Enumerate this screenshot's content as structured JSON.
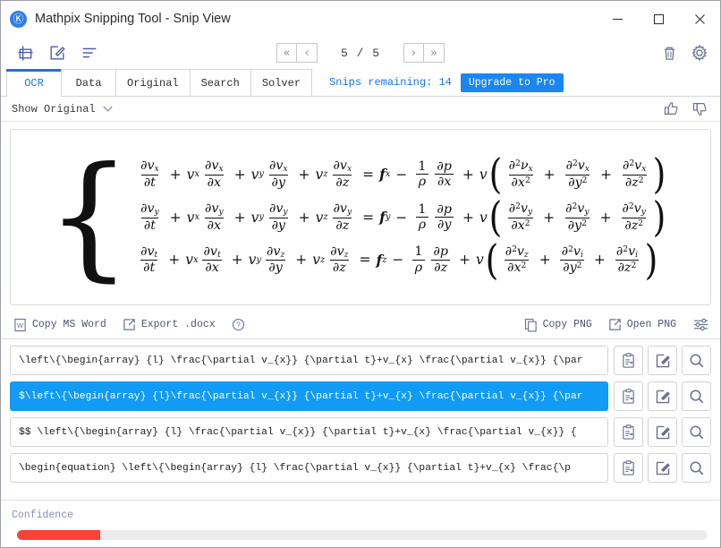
{
  "window": {
    "title": "Mathpix Snipping Tool - Snip View",
    "logo_glyph": "Ⓚ",
    "minimize_label": "–",
    "maximize_label": "□",
    "close_label": "✕"
  },
  "toolbar": {
    "icons": [
      {
        "name": "new-snip-icon",
        "label": "New Snip"
      },
      {
        "name": "edit-snip-icon",
        "label": "Edit Snip"
      },
      {
        "name": "list-view-icon",
        "label": "List View"
      }
    ],
    "pager": {
      "first_label": "«",
      "prev_label": "‹",
      "count": "5 / 5",
      "next_label": "›",
      "last_label": "»"
    },
    "right_icons": [
      {
        "name": "trash-icon",
        "label": "Delete"
      },
      {
        "name": "gear-icon",
        "label": "Settings"
      }
    ]
  },
  "tabs": [
    {
      "label": "OCR",
      "active": true
    },
    {
      "label": "Data",
      "active": false
    },
    {
      "label": "Original",
      "active": false
    },
    {
      "label": "Search",
      "active": false
    },
    {
      "label": "Solver",
      "active": false
    }
  ],
  "snips": {
    "remaining_text": "Snips remaining: 14",
    "upgrade_label": "Upgrade to Pro"
  },
  "show_original": {
    "label": "Show Original",
    "thumbs_up": "thumbs-up-icon",
    "thumbs_down": "thumbs-down-icon"
  },
  "equation": {
    "description": "Navier-Stokes momentum equations, three component rows",
    "rows": [
      {
        "lhs_terms": [
          {
            "num": "∂v",
            "num_sub": "x",
            "den": "∂t"
          },
          {
            "coef": "v",
            "coef_sub": "x",
            "num": "∂v",
            "num_sub": "x",
            "den": "∂x"
          },
          {
            "coef": "v",
            "coef_sub": "y",
            "num": "∂v",
            "num_sub": "x",
            "den": "∂y"
          },
          {
            "coef": "v",
            "coef_sub": "z",
            "num": "∂v",
            "num_sub": "x",
            "den": "∂z"
          }
        ],
        "rhs_force": "f",
        "rhs_force_sub": "x",
        "pressure_den": "∂x",
        "visc_terms": [
          {
            "num": "∂²ν",
            "num_sub": "x",
            "den": "∂x",
            "den_sup": "2"
          },
          {
            "num": "∂²v",
            "num_sub": "x",
            "den": "∂y",
            "den_sup": "2"
          },
          {
            "num": "∂²v",
            "num_sub": "x",
            "den": "∂z",
            "den_sup": "2"
          }
        ]
      },
      {
        "lhs_terms": [
          {
            "num": "∂v",
            "num_sub": "y",
            "den": "∂t"
          },
          {
            "coef": "v",
            "coef_sub": "x",
            "num": "∂v",
            "num_sub": "y",
            "den": "∂x"
          },
          {
            "coef": "v",
            "coef_sub": "y",
            "num": "∂v",
            "num_sub": "y",
            "den": "∂y"
          },
          {
            "coef": "v",
            "coef_sub": "z",
            "num": "∂v",
            "num_sub": "y",
            "den": "∂z"
          }
        ],
        "rhs_force": "f",
        "rhs_force_sub": "y",
        "pressure_den": "∂y",
        "visc_terms": [
          {
            "num": "∂²v",
            "num_sub": "y",
            "den": "∂x",
            "den_sup": "2"
          },
          {
            "num": "∂²v",
            "num_sub": "y",
            "den": "∂y",
            "den_sup": "2"
          },
          {
            "num": "∂²v",
            "num_sub": "y",
            "den": "∂z",
            "den_sup": "2"
          }
        ]
      },
      {
        "lhs_terms": [
          {
            "num": "∂v",
            "num_sub": "t",
            "den": "∂t"
          },
          {
            "coef": "v",
            "coef_sub": "x",
            "num": "∂v",
            "num_sub": "t",
            "den": "∂x"
          },
          {
            "coef": "v",
            "coef_sub": "y",
            "num": "∂v",
            "num_sub": "z",
            "den": "∂y"
          },
          {
            "coef": "v",
            "coef_sub": "z",
            "num": "∂v",
            "num_sub": "z",
            "den": "∂z"
          }
        ],
        "rhs_force": "f",
        "rhs_force_sub": "z",
        "pressure_den": "∂z",
        "visc_terms": [
          {
            "num": "∂²v",
            "num_sub": "z",
            "den": "∂x",
            "den_sup": "2"
          },
          {
            "num": "∂²v",
            "num_sub": "i",
            "den": "∂y",
            "den_sup": "2"
          },
          {
            "num": "∂²v",
            "num_sub": "i",
            "den": "∂z",
            "den_sup": "2"
          }
        ]
      }
    ],
    "symbols": {
      "plus": "+",
      "equals": "=",
      "minus": "−",
      "one": "1",
      "rho": "ρ",
      "partial_p": "∂p",
      "nu": "v"
    }
  },
  "action_bar": {
    "copy_ms_word": "Copy MS Word",
    "export_docx": "Export .docx",
    "help": "?",
    "copy_png": "Copy PNG",
    "open_png": "Open PNG",
    "settings_icon": "sliders-icon"
  },
  "results": [
    {
      "text": "\\left\\{\\begin{array} {l} \\frac{\\partial v_{x}} {\\partial t}+v_{x} \\frac{\\partial v_{x}} {\\par",
      "selected": false
    },
    {
      "text": "$\\left\\{\\begin{array} {l}\\frac{\\partial v_{x}} {\\partial t}+v_{x} \\frac{\\partial v_{x}} {\\par",
      "selected": true
    },
    {
      "text": "$$  \\left\\{\\begin{array} {l} \\frac{\\partial v_{x}} {\\partial t}+v_{x} \\frac{\\partial v_{x}} {",
      "selected": false
    },
    {
      "text": "\\begin{equation}  \\left\\{\\begin{array} {l} \\frac{\\partial v_{x}} {\\partial t}+v_{x} \\frac{\\p",
      "selected": false
    }
  ],
  "row_buttons": [
    {
      "name": "copy-row-icon",
      "label": "Copy"
    },
    {
      "name": "edit-row-icon",
      "label": "Edit"
    },
    {
      "name": "preview-row-icon",
      "label": "Preview"
    }
  ],
  "confidence": {
    "label": "Confidence",
    "percent": 12,
    "fill_color": "#f9423a",
    "track_color": "#ececec"
  }
}
